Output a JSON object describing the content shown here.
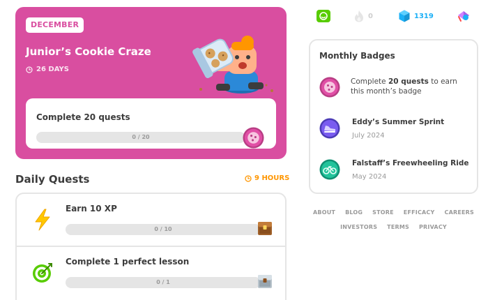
{
  "challenge": {
    "month": "DECEMBER",
    "title": "Junior’s Cookie Craze",
    "days": "26 DAYS",
    "goal": "Complete 20 quests",
    "progress_text": "0 / 20",
    "progress": 0,
    "accent": "#d94ea0"
  },
  "daily_quests": {
    "title": "Daily Quests",
    "timer": "9 HOURS",
    "items": [
      {
        "label": "Earn 10 XP",
        "progress_text": "0 / 10",
        "icon": "lightning-icon",
        "progress": 0
      },
      {
        "label": "Complete 1 perfect lesson",
        "progress_text": "0 / 1",
        "icon": "target-icon",
        "progress": 0
      }
    ]
  },
  "stats": {
    "streak": "0",
    "gems": "1319",
    "gem_color": "#1cb0f6"
  },
  "monthly_badges": {
    "title": "Monthly Badges",
    "current": {
      "pre": "Complete ",
      "bold": "20 quests",
      "post": " to earn this month’s badge"
    },
    "items": [
      {
        "name": "Eddy’s Summer Sprint",
        "date": "July 2024",
        "icon": "shoe-badge-icon"
      },
      {
        "name": "Falstaff’s Freewheeling Ride",
        "date": "May 2024",
        "icon": "bicycle-badge-icon"
      }
    ]
  },
  "footer": {
    "row1": [
      "ABOUT",
      "BLOG",
      "STORE",
      "EFFICACY",
      "CAREERS"
    ],
    "row2": [
      "INVESTORS",
      "TERMS",
      "PRIVACY"
    ]
  }
}
